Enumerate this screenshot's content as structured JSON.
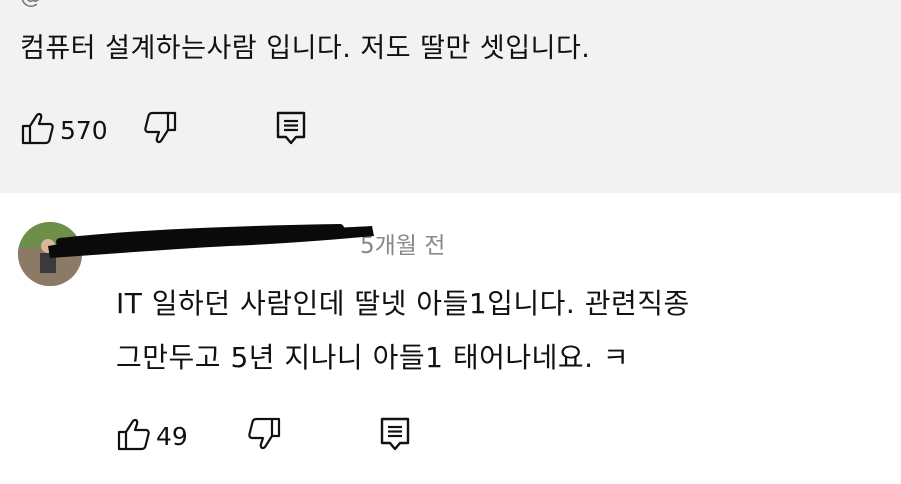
{
  "comment1": {
    "header_partial": "@",
    "text": "컴퓨터 설계하는사람 입니다. 저도 딸만 셋입니다.",
    "like_count": "570"
  },
  "comment2": {
    "time_ago": "5개월 전",
    "line1": "IT 일하던 사람인데 딸넷 아들1입니다. 관련직종",
    "line2": "그만두고 5년 지나니 아들1 태어나네요. ㅋ",
    "like_count": "49"
  },
  "icons": {
    "like": "thumbs-up-icon",
    "dislike": "thumbs-down-icon",
    "reply": "reply-icon"
  }
}
